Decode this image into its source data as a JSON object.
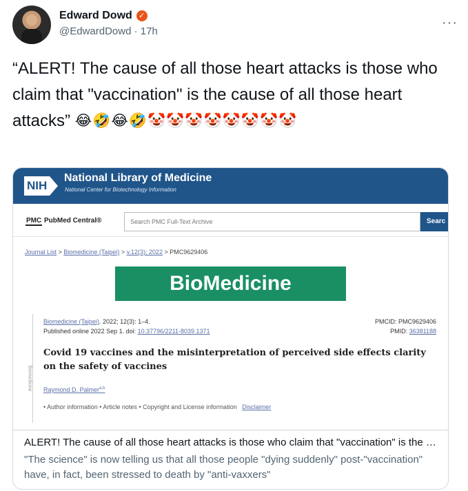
{
  "author": {
    "name": "Edward Dowd",
    "handle": "@EdwardDowd",
    "separator": "·",
    "time": "17h",
    "verified_glyph": "✓",
    "more_glyph": "···"
  },
  "tweet": {
    "text": "“ALERT! The cause of all those heart attacks is those who claim that \"vaccination\" is the cause of all those heart attacks”",
    "emojis": "😂🤣😂🤣🤡🤡🤡🤡🤡🤡🤡🤡"
  },
  "card": {
    "image": {
      "nih_logo": "NIH",
      "nlm_title": "National Library of Medicine",
      "nlm_subtitle": "National Center for Biotechnology Information",
      "pmc_logo_pmc": "PMC",
      "pmc_logo_text": "PubMed Central®",
      "search_placeholder": "Search PMC Full-Text Archive",
      "search_button": "Searc",
      "breadcrumb": {
        "journal_list": "Journal List",
        "sep": " > ",
        "journal": "Biomedicine (Taipei)",
        "issue": "v.12(3); 2022",
        "current": "PMC9629406"
      },
      "banner": "BioMedicine",
      "side_label": "Biomedicine",
      "citation": {
        "journal_link": "Biomedicine (Taipei)",
        "journal_rest": ". 2022; 12(3): 1–4.",
        "published": "Published online 2022 Sep 1. doi:",
        "doi": "10.37796/2211-8039.1371",
        "pmcid_label": "PMCID: PMC9629406",
        "pmid_label": "PMID:",
        "pmid": "36381188"
      },
      "article_title": "Covid 19 vaccines and the misinterpretation of perceived side effects clarity on the safety of vaccines",
      "author_name": "Raymond D. Palmer",
      "author_sup": "a,b",
      "info": {
        "author_information": "Author information",
        "article_notes": "Article notes",
        "copyright": "Copyright and License information",
        "disclaimer": "Disclaimer",
        "bullet": "•"
      }
    },
    "title": "ALERT! The cause of all those heart attacks is those who claim that \"vaccination\" is the cause of all those heart attacks",
    "description": "\"The science\" is now telling us that all those people \"dying suddenly\" post-\"vaccination\" have, in fact, been stressed to death by \"anti-vaxxers\""
  },
  "colors": {
    "nih_blue": "#20558a",
    "biomedicine_green": "#1a8f63",
    "verified_badge": "#e8541a",
    "secondary_text": "#536471"
  }
}
